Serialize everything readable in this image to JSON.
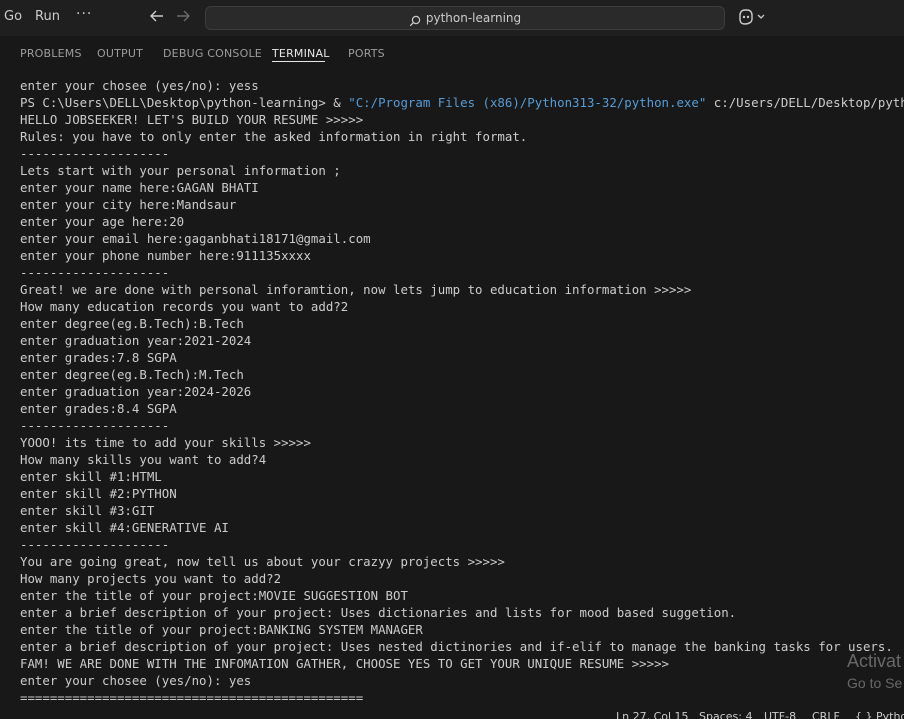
{
  "menu": {
    "go": "Go",
    "run": "Run",
    "more": "···"
  },
  "search": {
    "text": "python-learning"
  },
  "panel": {
    "tabs": [
      "PROBLEMS",
      "OUTPUT",
      "DEBUG CONSOLE",
      "TERMINAL",
      "PORTS"
    ],
    "active_tab": "TERMINAL"
  },
  "terminal": {
    "lines": [
      "enter your chosee (yes/no): yess",
      "PS C:\\Users\\DELL\\Desktop\\python-learning> & \"C:/Program Files (x86)/Python313-32/python.exe\" c:/Users/DELL/Desktop/python-learn",
      "HELLO JOBSEEKER! LET'S BUILD YOUR RESUME >>>>>",
      "Rules: you have to only enter the asked information in right format.",
      "--------------------",
      "Lets start with your personal information ;",
      "enter your name here:GAGAN BHATI",
      "enter your city here:Mandsaur",
      "enter your age here:20",
      "enter your email here:gaganbhati18171@gmail.com",
      "enter your phone number here:911135xxxx",
      "--------------------",
      "Great! we are done with personal inforamtion, now lets jump to education information >>>>>",
      "How many education records you want to add?2",
      "enter degree(eg.B.Tech):B.Tech",
      "enter graduation year:2021-2024",
      "enter grades:7.8 SGPA",
      "enter degree(eg.B.Tech):M.Tech",
      "enter graduation year:2024-2026",
      "enter grades:8.4 SGPA",
      "--------------------",
      "YOOO! its time to add your skills >>>>>",
      "How many skills you want to add?4",
      "enter skill #1:HTML",
      "enter skill #2:PYTHON",
      "enter skill #3:GIT",
      "enter skill #4:GENERATIVE AI",
      "--------------------",
      "You are going great, now tell us about your crazyy projects >>>>>",
      "How many projects you want to add?2",
      "enter the title of your project:MOVIE SUGGESTION BOT",
      "enter a brief description of your project: Uses dictionaries and lists for mood based suggetion.",
      "enter the title of your project:BANKING SYSTEM MANAGER",
      "enter a brief description of your project: Uses nested dictinories and if-elif to manage the banking tasks for users.",
      "FAM! WE ARE DONE WITH THE INFOMATION GATHER, CHOOSE YES TO GET YOUR UNIQUE RESUME >>>>>",
      "enter your chosee (yes/no): yes",
      "=============================================="
    ],
    "ps_prefix": "PS C:\\Users\\DELL\\Desktop\\python-learning> & ",
    "ps_string": "\"C:/Program Files (x86)/Python313-32/python.exe\"",
    "ps_suffix": " c:/Users/DELL/Desktop/python-learn"
  },
  "watermark": {
    "line1": "Activat",
    "line2": "Go to Se"
  },
  "statusbar": {
    "position": "Ln 27, Col 15",
    "spaces": "Spaces: 4",
    "encoding": "UTF-8",
    "eol": "CRLF",
    "language": "{ } Python"
  },
  "colors": {
    "background": "#181818",
    "text": "#cccccc",
    "string": "#569cd6"
  }
}
